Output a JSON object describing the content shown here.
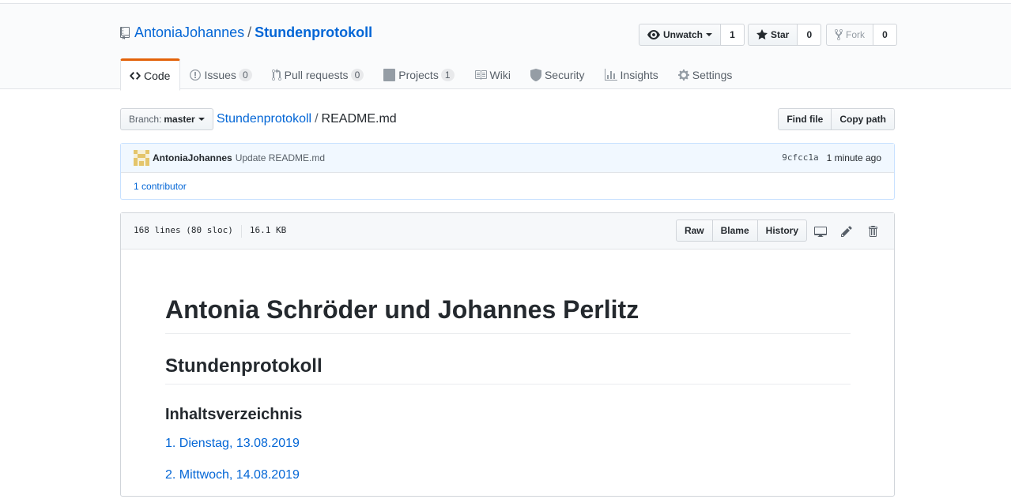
{
  "repo": {
    "owner": "AntoniaJohannes",
    "separator": "/",
    "name": "Stundenprotokoll"
  },
  "actions": {
    "watch_label": "Unwatch",
    "watch_count": "1",
    "star_label": "Star",
    "star_count": "0",
    "fork_label": "Fork",
    "fork_count": "0"
  },
  "nav": {
    "code": "Code",
    "issues": "Issues",
    "issues_count": "0",
    "pulls": "Pull requests",
    "pulls_count": "0",
    "projects": "Projects",
    "projects_count": "1",
    "wiki": "Wiki",
    "security": "Security",
    "insights": "Insights",
    "settings": "Settings"
  },
  "filenav": {
    "branch_label": "Branch:",
    "branch_value": "master",
    "breadcrumb_repo": "Stundenprotokoll",
    "breadcrumb_sep": "/",
    "breadcrumb_file": "README.md",
    "find_file": "Find file",
    "copy_path": "Copy path"
  },
  "commit": {
    "author": "AntoniaJohannes",
    "message": "Update README.md",
    "sha": "9cfcc1a",
    "time": "1 minute ago",
    "contributors_count": "1",
    "contributors_label": "contributor"
  },
  "file": {
    "lines": "168 lines (80 sloc)",
    "size": "16.1 KB",
    "raw": "Raw",
    "blame": "Blame",
    "history": "History"
  },
  "readme": {
    "h1": "Antonia Schröder und Johannes Perlitz",
    "h2": "Stundenprotokoll",
    "h3": "Inhaltsverzeichnis",
    "toc": [
      "1. Dienstag, 13.08.2019",
      "2. Mittwoch, 14.08.2019"
    ]
  },
  "colors": {
    "link": "#0366d6",
    "nav_active": "#e36209",
    "commit_bg": "#f1f8ff"
  }
}
